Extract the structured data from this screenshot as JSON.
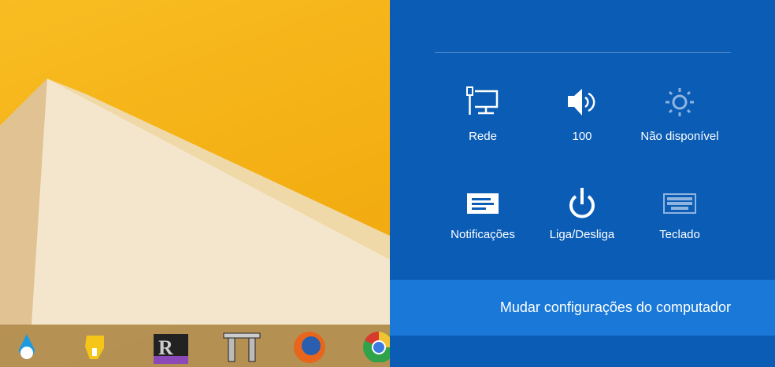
{
  "settings": {
    "tiles": [
      {
        "label": "Rede",
        "icon": "network-icon"
      },
      {
        "label": "100",
        "icon": "volume-icon"
      },
      {
        "label": "Não disponível",
        "icon": "brightness-icon"
      },
      {
        "label": "Notificações",
        "icon": "notifications-icon"
      },
      {
        "label": "Liga/Desliga",
        "icon": "power-icon"
      },
      {
        "label": "Teclado",
        "icon": "keyboard-icon"
      }
    ],
    "change_settings": "Mudar configurações do computador"
  },
  "taskbar": {
    "apps": [
      "app-v4-blue",
      "app-v4-yellow",
      "app-rx",
      "app-columns",
      "firefox",
      "chrome"
    ]
  },
  "colors": {
    "panel": "#0a5cb5",
    "highlight": "#1a79d8",
    "desktop": "#f6b418"
  }
}
